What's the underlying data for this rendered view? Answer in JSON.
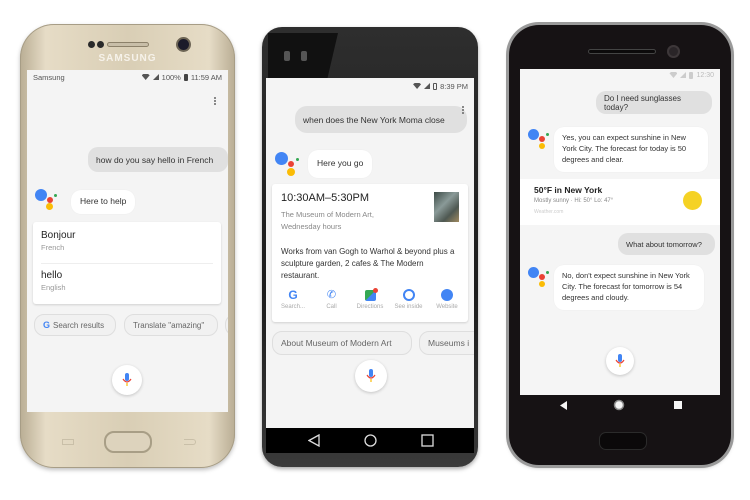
{
  "colors": {
    "google_blue": "#4285F4",
    "google_red": "#EA4335",
    "google_yellow": "#FBBC05",
    "google_green": "#34A853",
    "sun_yellow": "#F5D224"
  },
  "phone1": {
    "brand": "SAMSUNG",
    "status": {
      "carrier": "Samsung",
      "battery": "100%",
      "time": "11:59 AM"
    },
    "menu_icon": "more-vert-icon",
    "user_query": "how do you say hello in French",
    "assistant_reply": "Here to help",
    "translation_card": [
      {
        "word": "Bonjour",
        "language": "French"
      },
      {
        "word": "hello",
        "language": "English"
      }
    ],
    "suggestion_chips": [
      "Search results",
      "Translate \"amazing\""
    ],
    "mic_icon": "mic-icon"
  },
  "phone2": {
    "status": {
      "time": "8:39 PM"
    },
    "user_query": "when does the New York Moma close",
    "assistant_reply": "Here you go",
    "result_card": {
      "hours": "10:30AM–5:30PM",
      "place": "The Museum of Modern Art,",
      "day": "Wednesday hours",
      "description": "Works from van Gogh to Warhol & beyond plus a sculpture garden, 2 cafes & The Modern restaurant.",
      "actions": [
        {
          "label": "Search...",
          "icon": "google-g-icon"
        },
        {
          "label": "Call",
          "icon": "phone-icon"
        },
        {
          "label": "Directions",
          "icon": "maps-icon"
        },
        {
          "label": "See inside",
          "icon": "street-view-icon"
        },
        {
          "label": "Website",
          "icon": "globe-icon"
        }
      ]
    },
    "suggestion_chips": [
      "About Museum of Modern Art",
      "Museums i"
    ],
    "nav": [
      "back",
      "home",
      "recents"
    ]
  },
  "phone3": {
    "status": {
      "time": "12:30"
    },
    "user_query_1": "Do I need sunglasses today?",
    "assistant_reply_1": "Yes, you can expect sunshine in New York City. The forecast for today is 50 degrees and clear.",
    "weather_card": {
      "title": "50°F in New York",
      "detail": "Mostly sunny · Hi: 50° Lo: 47°",
      "source": "Weather.com"
    },
    "user_query_2": "What about tomorrow?",
    "assistant_reply_2": "No, don't expect sunshine in New York City. The forecast for tomorrow is 54 degrees and cloudy.",
    "nav": [
      "back",
      "home",
      "recents"
    ]
  }
}
